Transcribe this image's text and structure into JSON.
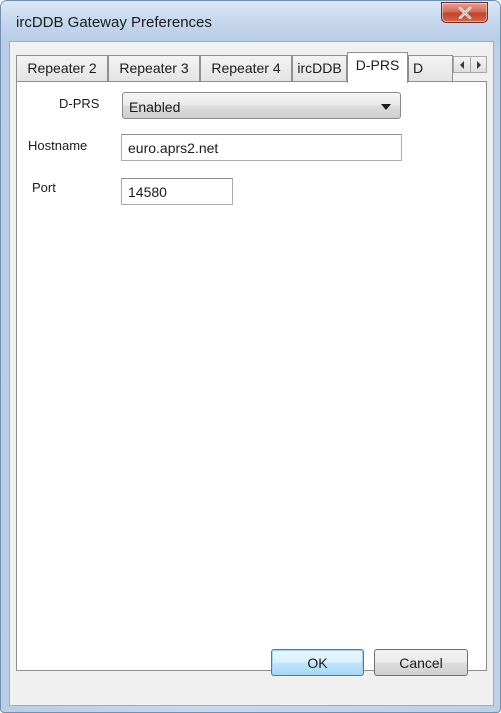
{
  "window": {
    "title": "ircDDB Gateway Preferences",
    "close_icon": "close-icon"
  },
  "tabs": [
    {
      "label": "Repeater 2",
      "selected": false
    },
    {
      "label": "Repeater 3",
      "selected": false
    },
    {
      "label": "Repeater 4",
      "selected": false
    },
    {
      "label": "ircDDB",
      "selected": false
    },
    {
      "label": "D-PRS",
      "selected": true
    },
    {
      "label": "D",
      "selected": false
    }
  ],
  "tab_scroll": {
    "left_icon": "arrow-left-icon",
    "right_icon": "arrow-right-icon"
  },
  "dprs_page": {
    "dprs_label": "D-PRS",
    "dprs_value": "Enabled",
    "hostname_label": "Hostname",
    "hostname_value": "euro.aprs2.net",
    "port_label": "Port",
    "port_value": "14580"
  },
  "buttons": {
    "ok": "OK",
    "cancel": "Cancel"
  },
  "colors": {
    "title_bar": "#c6d8ee",
    "close_button": "#c3422a",
    "default_button": "#3c7fb1"
  }
}
